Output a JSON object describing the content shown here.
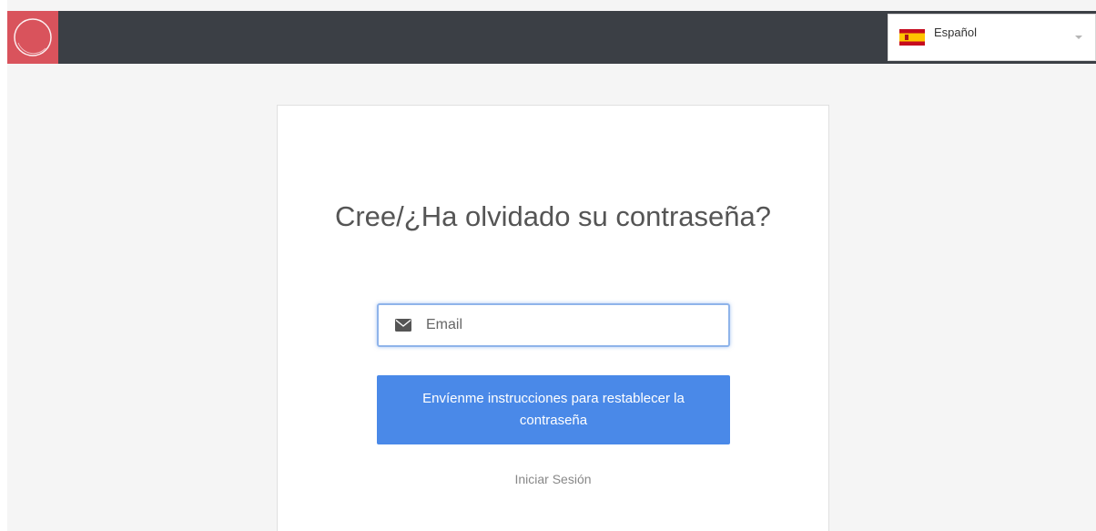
{
  "header": {
    "logo_icon": "circle-logo-icon",
    "language_selector": {
      "selected_label": "Español",
      "flag_icon": "spain-flag-icon",
      "caret_icon": "chevron-down-icon"
    }
  },
  "form": {
    "title": "Cree/¿Ha olvidado su contraseña?",
    "email": {
      "placeholder": "Email",
      "value": "",
      "icon": "envelope-icon"
    },
    "submit_label": "Envíenme instrucciones para restablecer la contraseña",
    "login_link_label": "Iniciar Sesión"
  },
  "colors": {
    "topbar": "#3b3f45",
    "logo_background": "#d9535c",
    "primary_button": "#4a89e8",
    "page_background": "#f5f5f5"
  }
}
